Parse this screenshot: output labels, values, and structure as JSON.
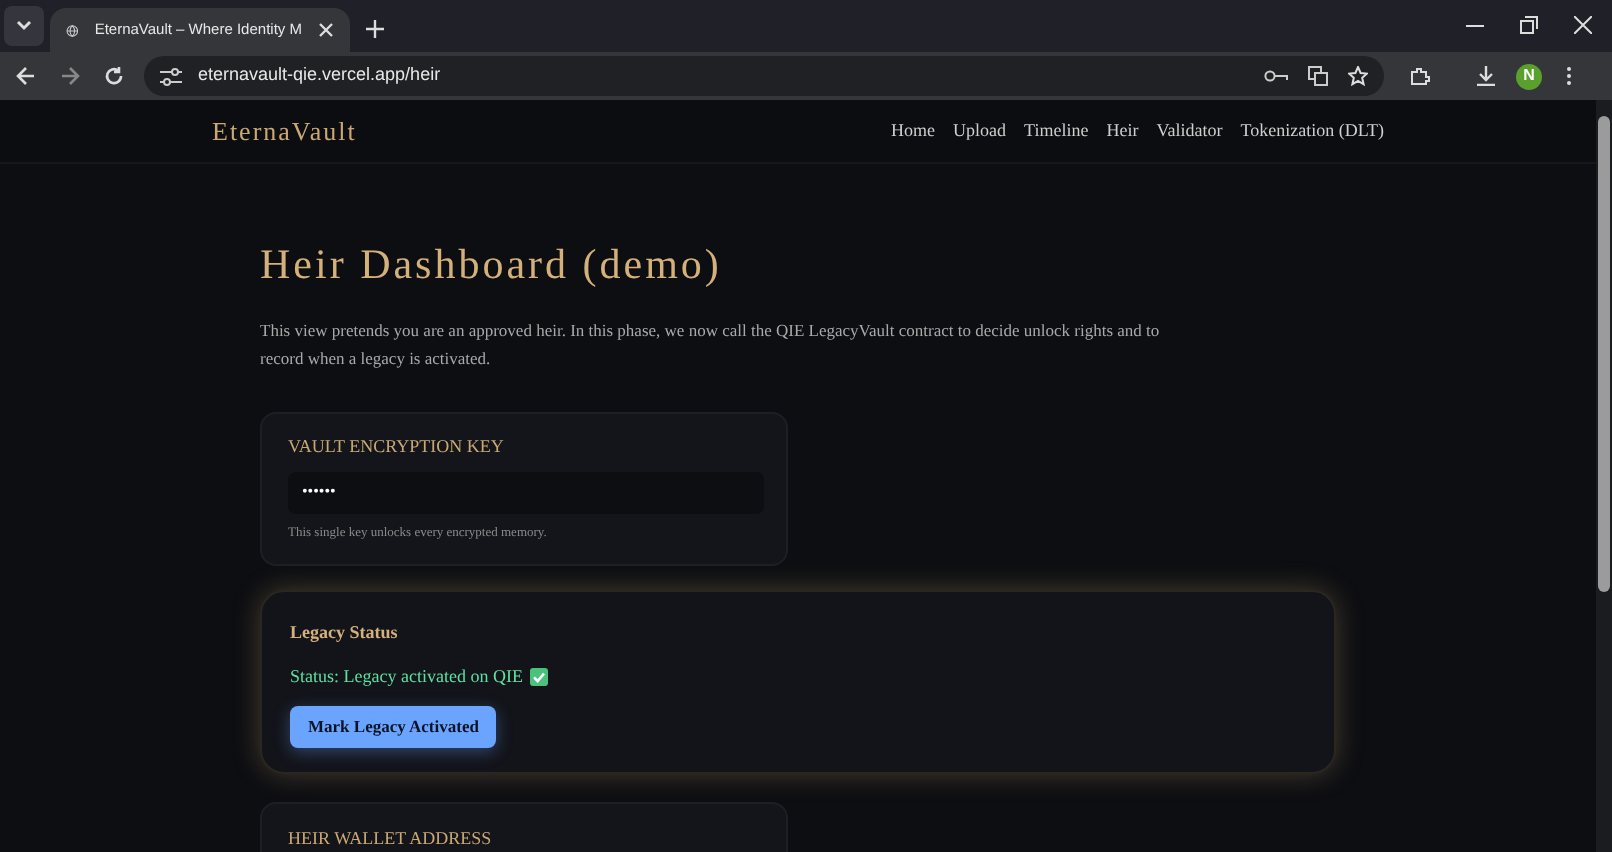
{
  "browser": {
    "tab_title": "EternaVault – Where Identity M",
    "url": "eternavault-qie.vercel.app/heir",
    "profile_initial": "N"
  },
  "nav": {
    "logo": "EternaVault",
    "links": [
      {
        "label": "Home"
      },
      {
        "label": "Upload"
      },
      {
        "label": "Timeline"
      },
      {
        "label": "Heir"
      },
      {
        "label": "Validator"
      },
      {
        "label": "Tokenization (DLT)"
      }
    ]
  },
  "page": {
    "title": "Heir Dashboard (demo)",
    "intro": "This view pretends you are an approved heir. In this phase, we now call the QIE LegacyVault contract to decide unlock rights and to record when a legacy is activated."
  },
  "key_card": {
    "label": "VAULT ENCRYPTION KEY",
    "value": "••••••",
    "hint": "This single key unlocks every encrypted memory."
  },
  "status_card": {
    "title": "Legacy Status",
    "status": "Status: Legacy activated on QIE",
    "activated": true,
    "button": "Mark Legacy Activated"
  },
  "wallet_card": {
    "label": "HEIR WALLET ADDRESS"
  }
}
